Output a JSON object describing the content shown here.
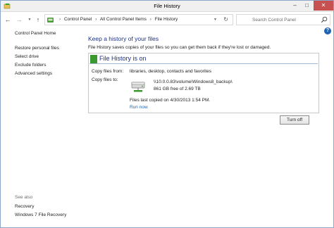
{
  "window": {
    "title": "File History",
    "controls": {
      "minimize": "–",
      "maximize": "□",
      "close": "✕"
    }
  },
  "address": {
    "breadcrumbs": [
      "Control Panel",
      "All Control Panel Items",
      "File History"
    ],
    "search_placeholder": "Search Control Panel"
  },
  "sidebar": {
    "home": "Control Panel Home",
    "links": [
      "Restore personal files",
      "Select drive",
      "Exclude folders",
      "Advanced settings"
    ],
    "see_also_label": "See also",
    "see_also_links": [
      "Recovery",
      "Windows 7 File Recovery"
    ]
  },
  "main": {
    "heading": "Keep a history of your files",
    "description": "File History saves copies of your files so you can get them back if they're lost or damaged.",
    "help": "?",
    "status": "File History is on",
    "copy_from_label": "Copy files from:",
    "copy_from_value": "libraries, desktop, contacts and favorites",
    "copy_to_label": "Copy files to:",
    "drive_path": "\\\\10.0.0.83\\volume\\Windows8_backup\\",
    "drive_free": "861 GB free of 2.69 TB",
    "last_copied": "Files last copied on 4/30/2013 1:54 PM.",
    "run_now": "Run now",
    "turn_off": "Turn off"
  },
  "colors": {
    "heading": "#1e3287",
    "link": "#1e64b4",
    "status_on": "#3a9a2f"
  }
}
